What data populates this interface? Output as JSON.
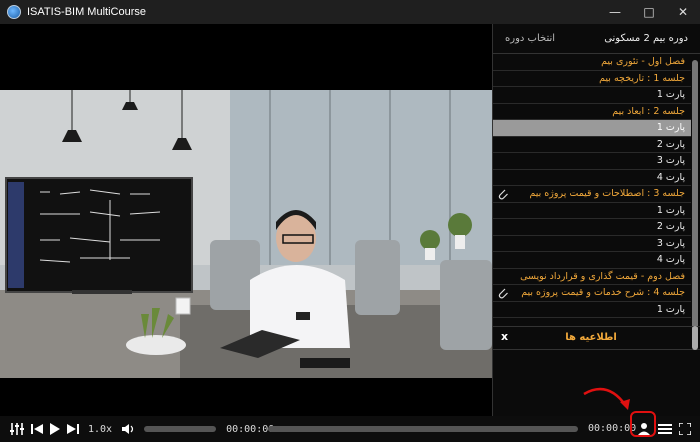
{
  "window": {
    "title": "ISATIS-BIM MultiCourse",
    "controls": [
      "minimize",
      "maximize",
      "close"
    ]
  },
  "sidebar": {
    "course_name": "دوره بیم 2 مسکونی",
    "select_course_label": "انتخاب دوره",
    "items": [
      {
        "type": "chapter",
        "label": "فصل اول - تئوری بیم"
      },
      {
        "type": "session",
        "label": "جلسه 1 : تاریخچه بیم"
      },
      {
        "type": "part",
        "label": "پارت 1"
      },
      {
        "type": "session",
        "label": "جلسه 2 : ابعاد بیم"
      },
      {
        "type": "part",
        "label": "پارت 1",
        "selected": true
      },
      {
        "type": "part",
        "label": "پارت 2"
      },
      {
        "type": "part",
        "label": "پارت 3"
      },
      {
        "type": "part",
        "label": "پارت 4"
      },
      {
        "type": "session",
        "label": "جلسه 3 : اصطلاحات و قیمت پروژه بیم",
        "attachment": true
      },
      {
        "type": "part",
        "label": "پارت 1"
      },
      {
        "type": "part",
        "label": "پارت 2"
      },
      {
        "type": "part",
        "label": "پارت 3"
      },
      {
        "type": "part",
        "label": "پارت 4"
      },
      {
        "type": "chapter",
        "label": "فصل دوم - قیمت گذاری و قرارداد نویسی"
      },
      {
        "type": "session",
        "label": "جلسه 4 : شرح خدمات و قیمت پروژه بیم",
        "attachment": true
      },
      {
        "type": "part",
        "label": "پارت 1"
      }
    ],
    "notice": {
      "label": "اطلاعیه ها",
      "close": "x"
    }
  },
  "player": {
    "speed": "1.0x",
    "current_time": "00:00:00",
    "total_time": "00:00:00",
    "progress": 0,
    "volume": 0
  },
  "colors": {
    "accent": "#f2a93b",
    "selected_row": "#9a9a9a",
    "highlight": "#e01010"
  },
  "icons": [
    "equalizer-icon",
    "skip-back-icon",
    "play-icon",
    "skip-forward-icon",
    "volume-icon",
    "user-lock-icon",
    "playlist-icon",
    "fullscreen-icon",
    "paperclip-icon"
  ]
}
